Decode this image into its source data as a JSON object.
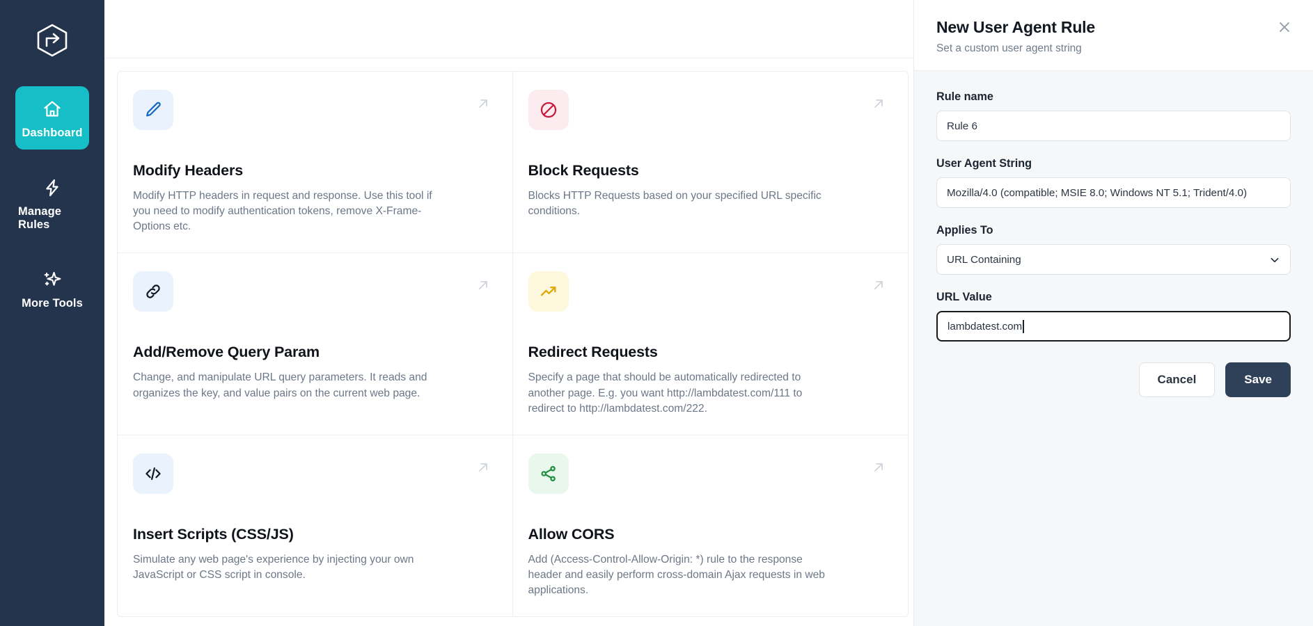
{
  "brand": {
    "logo_icon": "cube-arrow-logo",
    "sidebar_bg": "#24344c",
    "accent": "#16bfc7"
  },
  "sidebar": {
    "items": [
      {
        "label": "Dashboard",
        "icon": "home-icon",
        "active": true
      },
      {
        "label": "Manage Rules",
        "icon": "bolt-icon",
        "active": false
      },
      {
        "label": "More Tools",
        "icon": "sparkle-icon",
        "active": false
      }
    ]
  },
  "topbar": {
    "theme_toggle_icon": "sun-icon"
  },
  "cards": [
    {
      "title": "Modify Headers",
      "desc": "Modify HTTP headers in request and response. Use this tool if you need to modify authentication tokens, remove X-Frame-Options etc.",
      "icon": "pencil-icon",
      "tile_bg": "#eaf2fd",
      "icon_color": "#1668c1",
      "arrow_icon": "arrow-up-right-icon"
    },
    {
      "title": "Block Requests",
      "desc": "Blocks HTTP Requests based on your specified URL specific conditions.",
      "icon": "block-icon",
      "tile_bg": "#fdecef",
      "icon_color": "#c9183c",
      "arrow_icon": "arrow-up-right-icon"
    },
    {
      "title": "Add/Remove Query Param",
      "desc": "Change, and manipulate URL query parameters. It reads and organizes the key, and value pairs on the current web page.",
      "icon": "link-icon",
      "tile_bg": "#eaf2fd",
      "icon_color": "#14181f",
      "arrow_icon": "arrow-up-right-icon"
    },
    {
      "title": "Redirect Requests",
      "desc": "Specify a page that should be automatically redirected to another page. E.g. you want http://lambdatest.com/111 to redirect to http://lambdatest.com/222.",
      "icon": "trending-up-icon",
      "tile_bg": "#fdf7dd",
      "icon_color": "#e0a90a",
      "arrow_icon": "arrow-up-right-icon"
    },
    {
      "title": "Insert Scripts (CSS/JS)",
      "desc": "Simulate any web page's experience by injecting your own JavaScript or CSS script in console.",
      "icon": "code-icon",
      "tile_bg": "#eaf2fd",
      "icon_color": "#14181f",
      "arrow_icon": "arrow-up-right-icon"
    },
    {
      "title": "Allow CORS",
      "desc": "Add (Access-Control-Allow-Origin: *) rule to the response header and easily perform cross-domain Ajax requests in web applications.",
      "icon": "share-nodes-icon",
      "tile_bg": "#eaf7ec",
      "icon_color": "#1f8d3e",
      "arrow_icon": "arrow-up-right-icon"
    }
  ],
  "panel": {
    "title": "New User Agent Rule",
    "subtitle": "Set a custom user agent string",
    "close_icon": "close-icon",
    "fields": {
      "rule_name": {
        "label": "Rule name",
        "value": "Rule 6",
        "placeholder": "Rule name"
      },
      "user_agent_string": {
        "label": "User Agent String",
        "value": "Mozilla/4.0 (compatible; MSIE 8.0; Windows NT 5.1; Trident/4.0)",
        "placeholder": "User Agent String"
      },
      "applies_to": {
        "label": "Applies To",
        "value": "URL Containing",
        "chevron_icon": "chevron-down-icon",
        "options": [
          "URL Containing"
        ]
      },
      "url_value": {
        "label": "URL Value",
        "value": "lambdatest.com",
        "placeholder": "URL Value",
        "focused": true
      }
    },
    "actions": {
      "cancel_label": "Cancel",
      "save_label": "Save",
      "save_bg": "#2f4059"
    }
  }
}
